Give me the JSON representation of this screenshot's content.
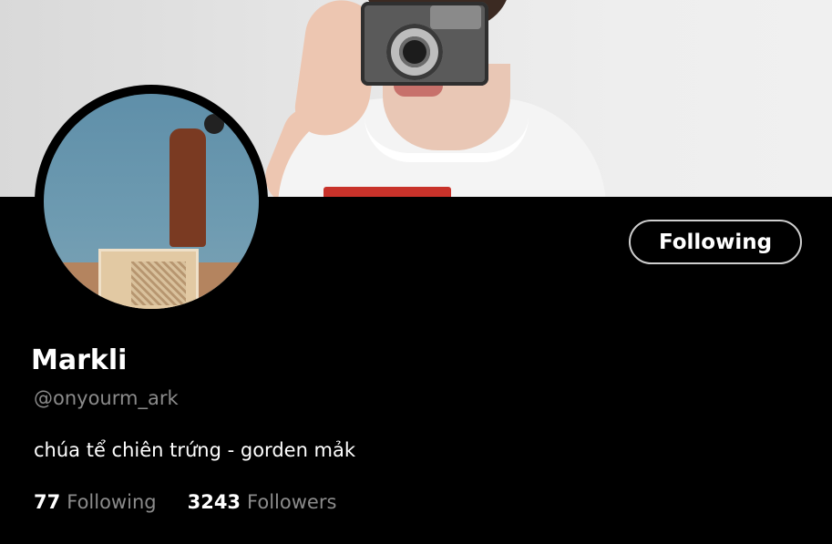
{
  "profile": {
    "display_name": "Markli",
    "handle": "@onyourm_ark",
    "bio": "chúa tể chiên trứng - gorden mảk",
    "follow_button_label": "Following"
  },
  "stats": {
    "following_count": "77",
    "following_label": "Following",
    "followers_count": "3243",
    "followers_label": "Followers"
  },
  "colors": {
    "background": "#000000",
    "primary_text": "#ffffff",
    "secondary_text": "#8b8b8b",
    "button_border": "#cfcfcf"
  }
}
